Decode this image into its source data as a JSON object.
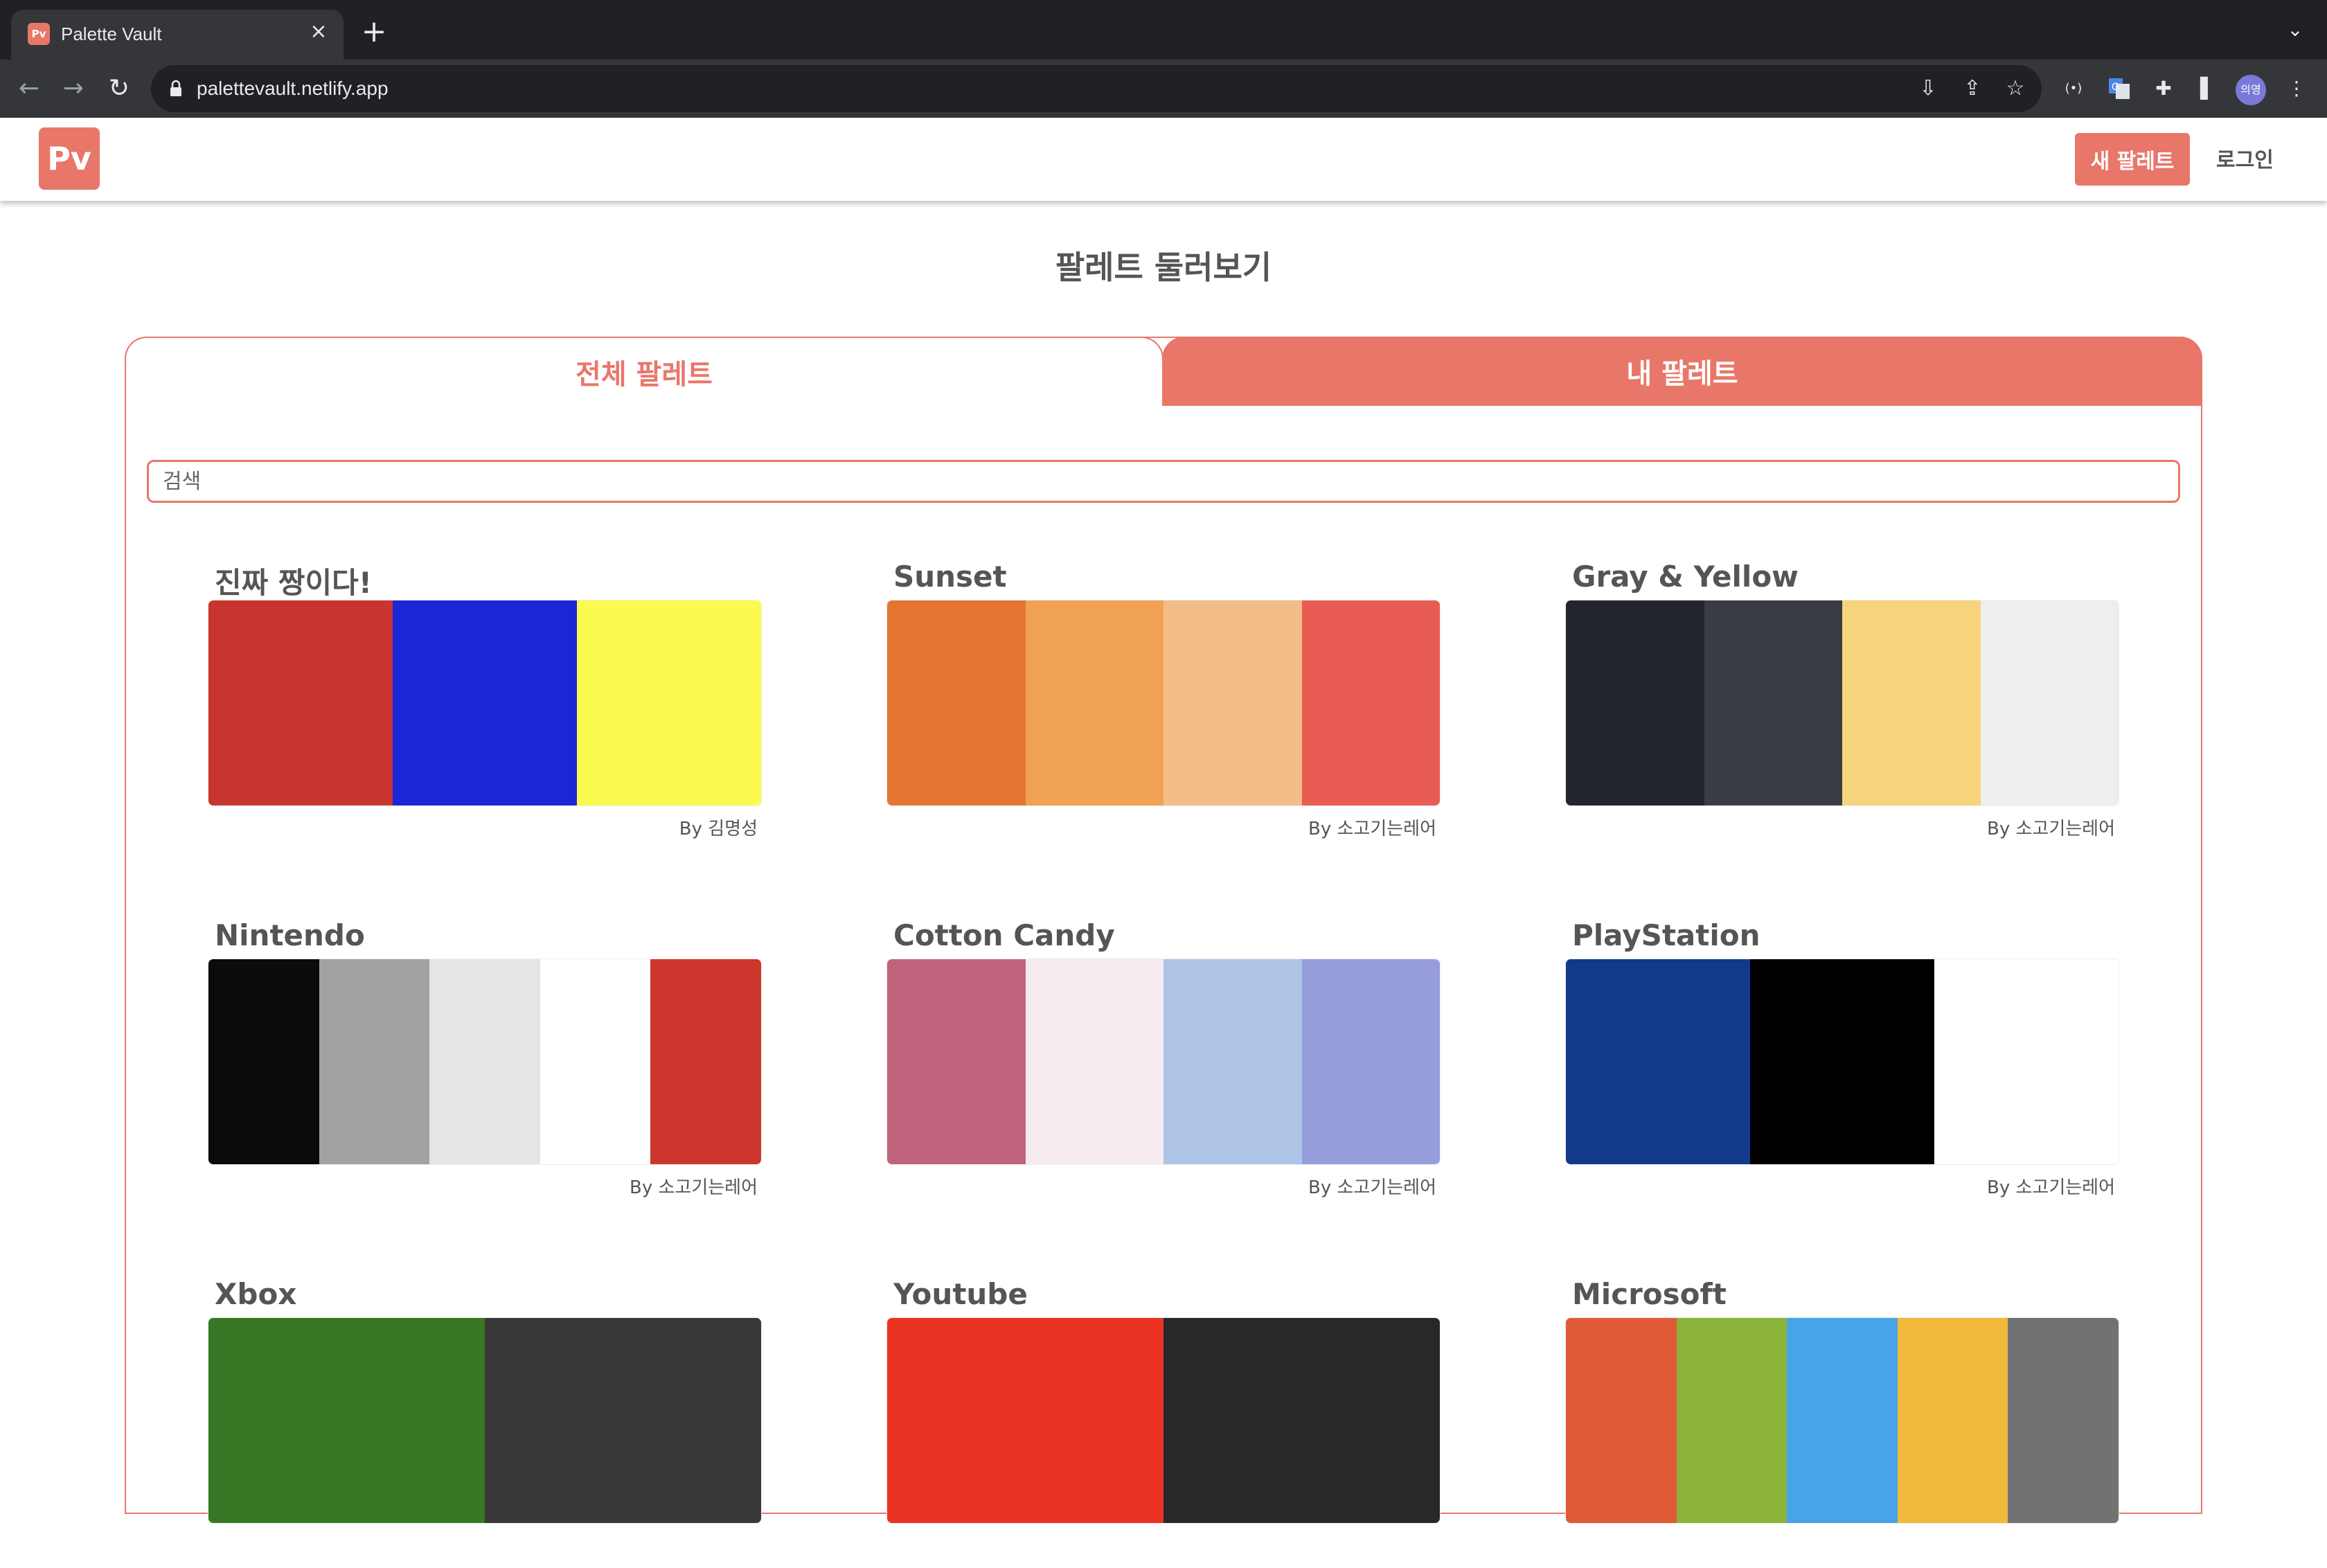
{
  "browser": {
    "tab_title": "Palette Vault",
    "favicon_text": "Pv",
    "url": "palettevault.netlify.app",
    "profile_initials": "의영"
  },
  "app": {
    "logo_text": "Pv",
    "new_palette_label": "새 팔레트",
    "login_label": "로그인",
    "page_title": "팔레트 둘러보기",
    "tabs": [
      {
        "label": "전체 팔레트",
        "active": true
      },
      {
        "label": "내 팔레트",
        "active": false
      }
    ],
    "search_placeholder": "검색",
    "accent_color": "#e8776a"
  },
  "palettes": [
    {
      "title": "진짜 짱이다!",
      "author": "By 김명성",
      "colors": [
        "#c8352e",
        "#1b26d6",
        "#fbfb4f"
      ]
    },
    {
      "title": "Sunset",
      "author": "By 소고기는레어",
      "colors": [
        "#e57532",
        "#f0a156",
        "#f3bd89",
        "#e85c54"
      ]
    },
    {
      "title": "Gray & Yellow",
      "author": "By 소고기는레어",
      "colors": [
        "#22252b",
        "#393c42",
        "#f6d47c",
        "#eeeeee"
      ]
    },
    {
      "title": "Nintendo",
      "author": "By 소고기는레어",
      "colors": [
        "#0b0b0b",
        "#a3a2a2",
        "#e5e5e5",
        "#ffffff",
        "#cd362c"
      ]
    },
    {
      "title": "Cotton Candy",
      "author": "By 소고기는레어",
      "colors": [
        "#c0637c",
        "#f5ebf0",
        "#adc4e7",
        "#979ddb"
      ]
    },
    {
      "title": "PlayStation",
      "author": "By 소고기는레어",
      "colors": [
        "#12398c",
        "#000000",
        "#ffffff"
      ]
    },
    {
      "title": "Xbox",
      "author": "",
      "colors": [
        "#377724",
        "#383838"
      ]
    },
    {
      "title": "Youtube",
      "author": "",
      "colors": [
        "#e93222",
        "#282828"
      ]
    },
    {
      "title": "Microsoft",
      "author": "",
      "colors": [
        "#e05a35",
        "#8cb43a",
        "#47a4e8",
        "#f1b83c",
        "#727272"
      ]
    }
  ]
}
